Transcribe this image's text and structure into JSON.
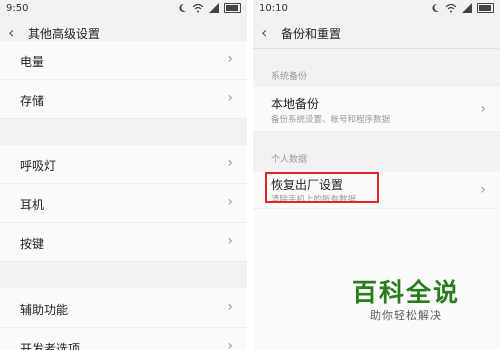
{
  "left": {
    "status": {
      "time": "9:50"
    },
    "title": "其他高级设置",
    "items": [
      {
        "label": "电量"
      },
      {
        "label": "存储"
      },
      {
        "label": "呼吸灯"
      },
      {
        "label": "耳机"
      },
      {
        "label": "按键"
      },
      {
        "label": "辅助功能"
      },
      {
        "label": "开发者选项"
      }
    ]
  },
  "right": {
    "status": {
      "time": "10:10"
    },
    "title": "备份和重置",
    "section_backup": "系统备份",
    "local_backup": {
      "title": "本地备份",
      "subtitle": "备份系统设置、帐号和程序数据"
    },
    "section_personal": "个人数据",
    "factory_reset": {
      "title": "恢复出厂设置",
      "subtitle": "清除手机上的所有数据"
    }
  },
  "watermark": {
    "main": "百科全说",
    "sub": "助你轻松解决"
  },
  "colors": {
    "highlight": "#e0262b",
    "watermark_green": "#2a7c1f"
  },
  "icons": [
    "moon-icon",
    "wifi-icon",
    "signal-icon",
    "battery-icon",
    "chevron-left-icon",
    "chevron-right-icon"
  ]
}
